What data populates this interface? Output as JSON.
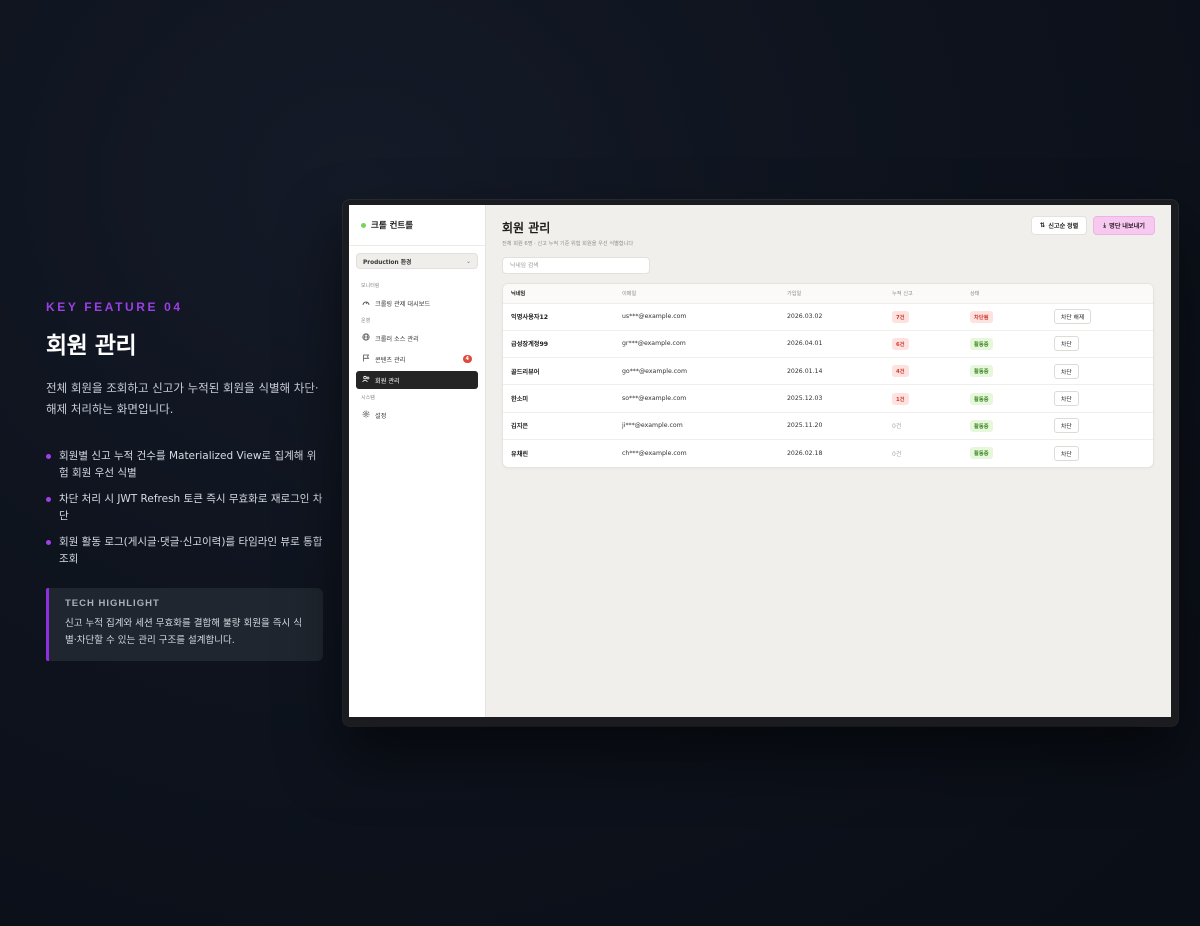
{
  "feature": {
    "kicker": "KEY FEATURE 04",
    "title": "회원 관리",
    "description": "전체 회원을 조회하고 신고가 누적된 회원을 식별해 차단·해제 처리하는 화면입니다.",
    "bullets": [
      "회원별 신고 누적 건수를 Materialized View로 집계해 위험 회원 우선 식별",
      "차단 처리 시 JWT Refresh 토큰 즉시 무효화로 재로그인 차단",
      "회원 활동 로그(게시글·댓글·신고이력)를 타임라인 뷰로 통합 조회"
    ],
    "highlight": {
      "label": "TECH HIGHLIGHT",
      "text": "신고 누적 집계와 세션 무효화를 결합해 불량 회원을 즉시 식별·차단할 수 있는 관리 구조를 설계합니다."
    }
  },
  "app": {
    "brand": "크롤 컨트롤",
    "env_select": "Production 환경",
    "nav": {
      "section_monitoring": "모니터링",
      "section_ops": "운영",
      "section_system": "시스템",
      "dashboard": "크롤링 관제 대시보드",
      "sources": "크롤러 소스 관리",
      "content": "콘텐츠 관리",
      "content_badge": "4",
      "members": "회원 관리",
      "settings": "설정"
    },
    "page": {
      "title": "회원 관리",
      "subtitle": "전체 회원 6명 · 신고 누적 기준 위험 회원을 우선 식별합니다",
      "sort_button": "신고순 정렬",
      "export_button": "명단 내보내기",
      "search_placeholder": "닉네임 검색"
    },
    "table": {
      "headers": [
        "닉네임",
        "이메일",
        "가입일",
        "누적 신고",
        "상태",
        ""
      ],
      "rows": [
        {
          "nick": "익명사용자12",
          "email": "us***@example.com",
          "joined": "2026.03.02",
          "reports": "7건",
          "status": "차단됨",
          "action": "차단 해제"
        },
        {
          "nick": "급성장계정99",
          "email": "gr***@example.com",
          "joined": "2026.04.01",
          "reports": "6건",
          "status": "활동중",
          "action": "차단"
        },
        {
          "nick": "골드리뷰어",
          "email": "go***@example.com",
          "joined": "2026.01.14",
          "reports": "4건",
          "status": "활동중",
          "action": "차단"
        },
        {
          "nick": "한소미",
          "email": "so***@example.com",
          "joined": "2025.12.03",
          "reports": "1건",
          "status": "활동중",
          "action": "차단"
        },
        {
          "nick": "김지은",
          "email": "ji***@example.com",
          "joined": "2025.11.20",
          "reports": "0건",
          "status": "활동중",
          "action": "차단"
        },
        {
          "nick": "유채린",
          "email": "ch***@example.com",
          "joined": "2026.02.18",
          "reports": "0건",
          "status": "활동중",
          "action": "차단"
        }
      ]
    }
  },
  "colors": {
    "accent_purple": "#9b3fe6",
    "brand_dot": "#7bd35a",
    "danger": "#d23a2e",
    "success": "#3f8a26",
    "export_pink": "#f7c9f0"
  }
}
